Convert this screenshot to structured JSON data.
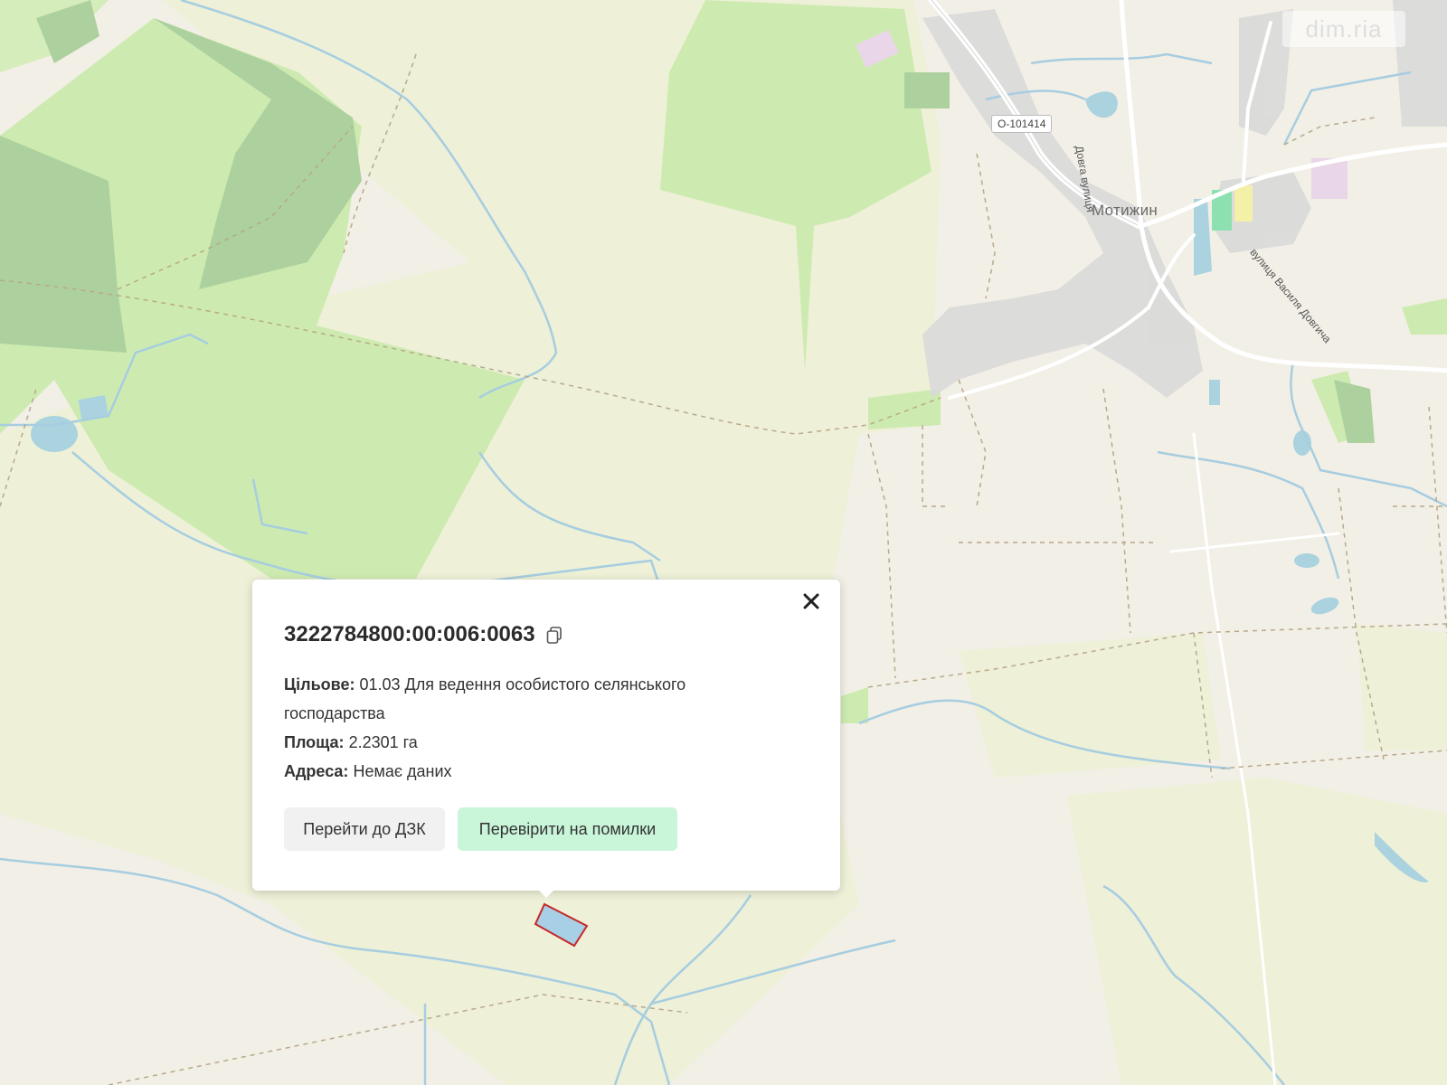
{
  "map": {
    "place_name": "Мотижин",
    "road_ref": "О-101414",
    "streets": [
      "Довга вулиця",
      "вулиця Василя Довгича"
    ],
    "watermark": "dim.ria",
    "colors": {
      "land": "#f2efe6",
      "farmland": "#eef0d8",
      "grass": "#cdebb0",
      "forest": "#add19e",
      "water": "#aad3df",
      "river": "#a6cde0",
      "built": "#d9d9d9",
      "boundary": "#b8a98a",
      "parcel_fill": "#a7d0e6",
      "parcel_stroke": "#c62828",
      "accent_green": "#c9f5d9"
    }
  },
  "popup": {
    "parcel_id": "3222784800:00:006:0063",
    "purpose_label": "Цільове:",
    "purpose_value": "01.03 Для ведення особистого селянського господарства",
    "area_label": "Площа:",
    "area_value": "2.2301 га",
    "address_label": "Адреса:",
    "address_value": "Немає даних",
    "btn_dzk": "Перейти до ДЗК",
    "btn_check": "Перевірити на помилки",
    "icons": {
      "close": "close-icon",
      "copy": "copy-icon"
    }
  }
}
